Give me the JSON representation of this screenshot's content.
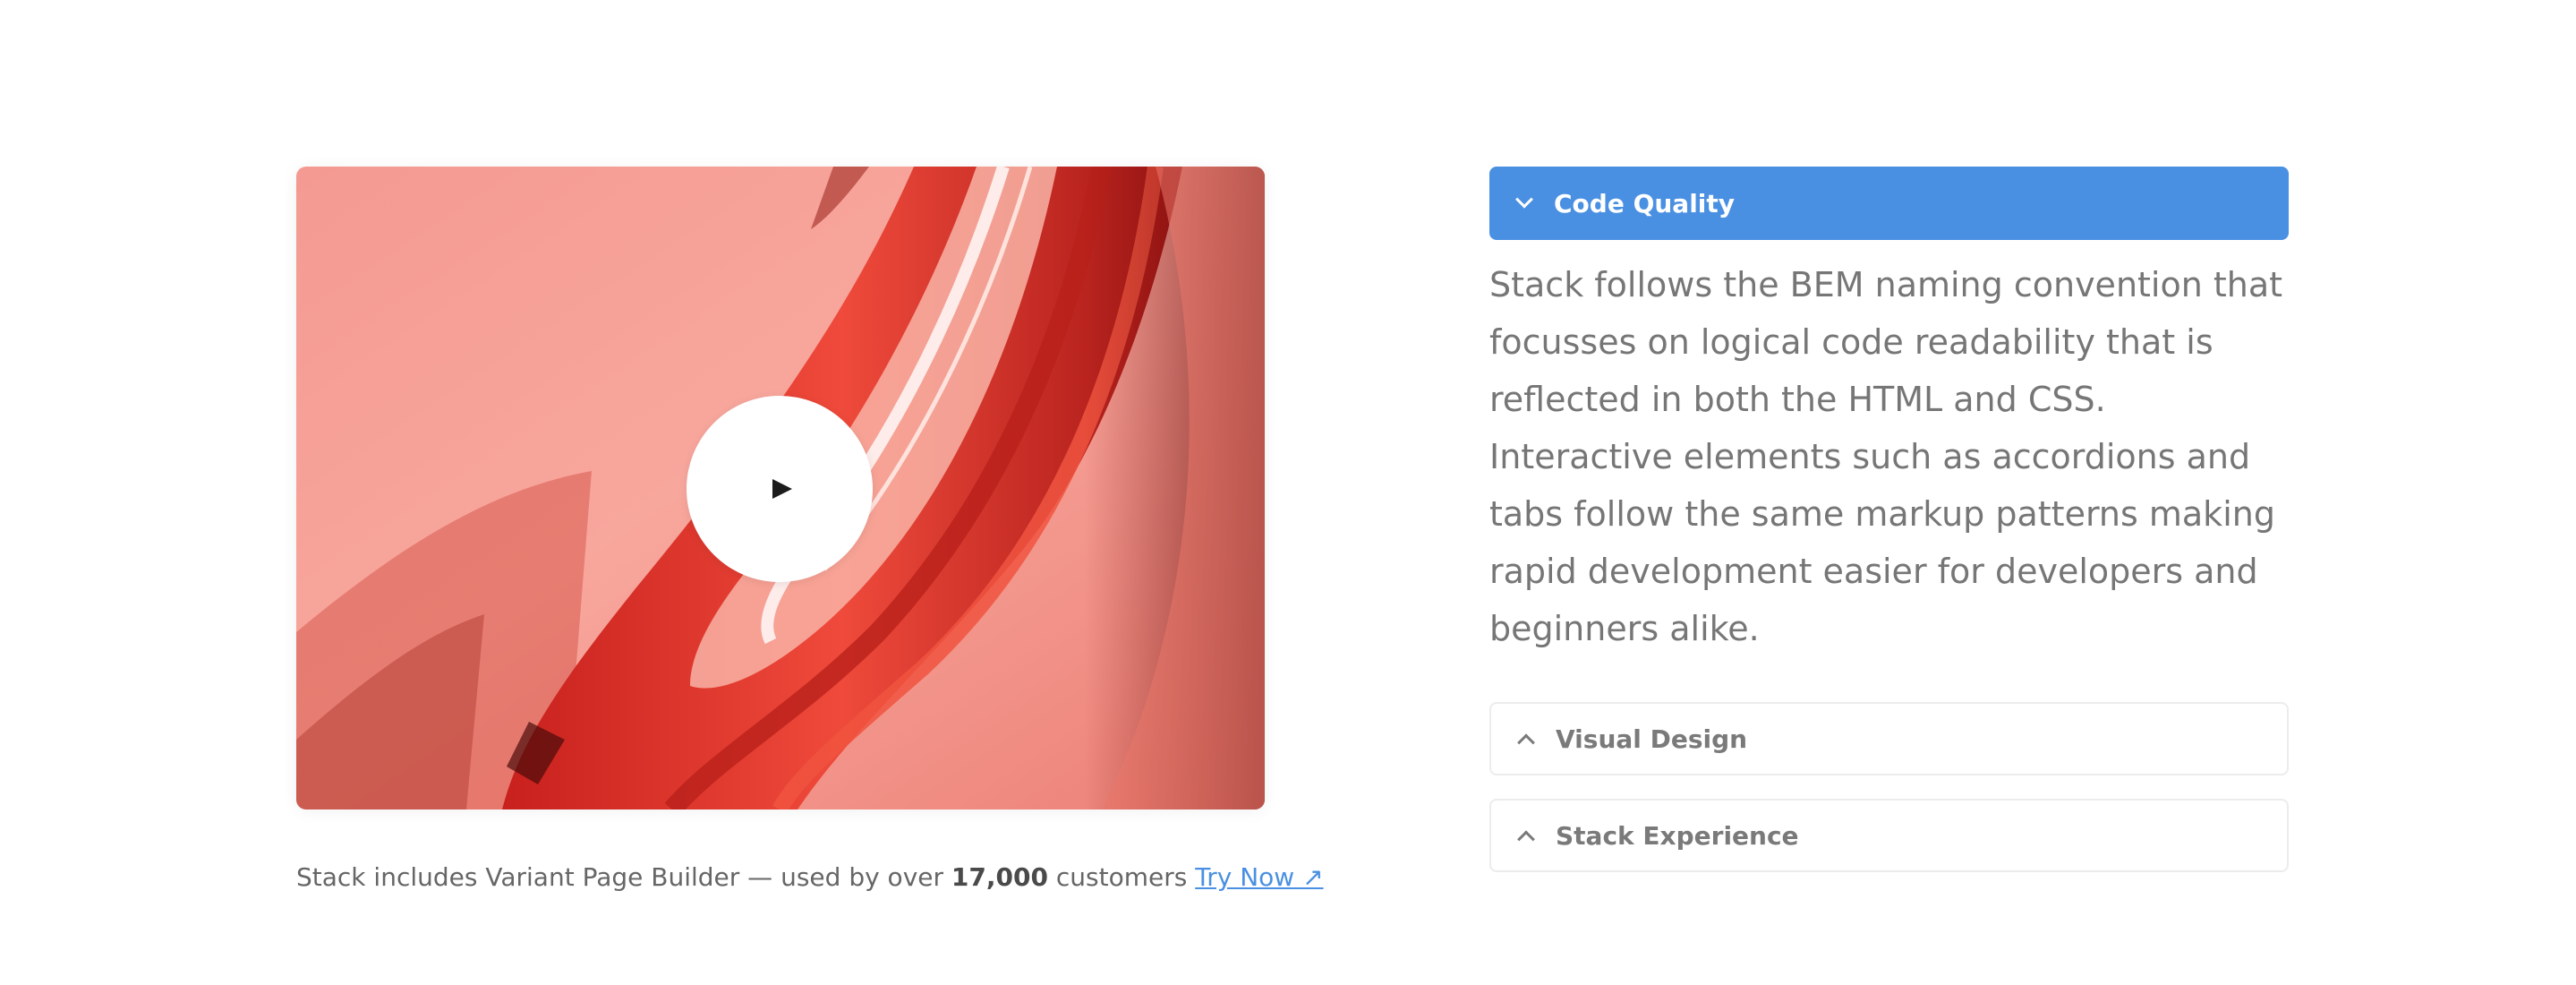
{
  "video": {
    "play_icon": "play-icon"
  },
  "caption": {
    "prefix": "Stack includes Variant Page Builder — used by over ",
    "count": "17,000",
    "suffix": " customers ",
    "link": "Try Now ↗"
  },
  "accordion": {
    "items": [
      {
        "title": "Code Quality",
        "expanded": true,
        "icon": "chevron-down-icon",
        "content": "Stack follows the BEM naming convention that focusses on logical code readability that is reflected in both the HTML and CSS. Interactive elements such as accordions and tabs follow the same markup patterns making rapid development easier for developers and beginners alike."
      },
      {
        "title": "Visual Design",
        "expanded": false,
        "icon": "chevron-up-icon"
      },
      {
        "title": "Stack Experience",
        "expanded": false,
        "icon": "chevron-up-icon"
      }
    ]
  },
  "colors": {
    "accent": "#4a90e2",
    "body_text": "#767676",
    "border": "#ececec"
  }
}
